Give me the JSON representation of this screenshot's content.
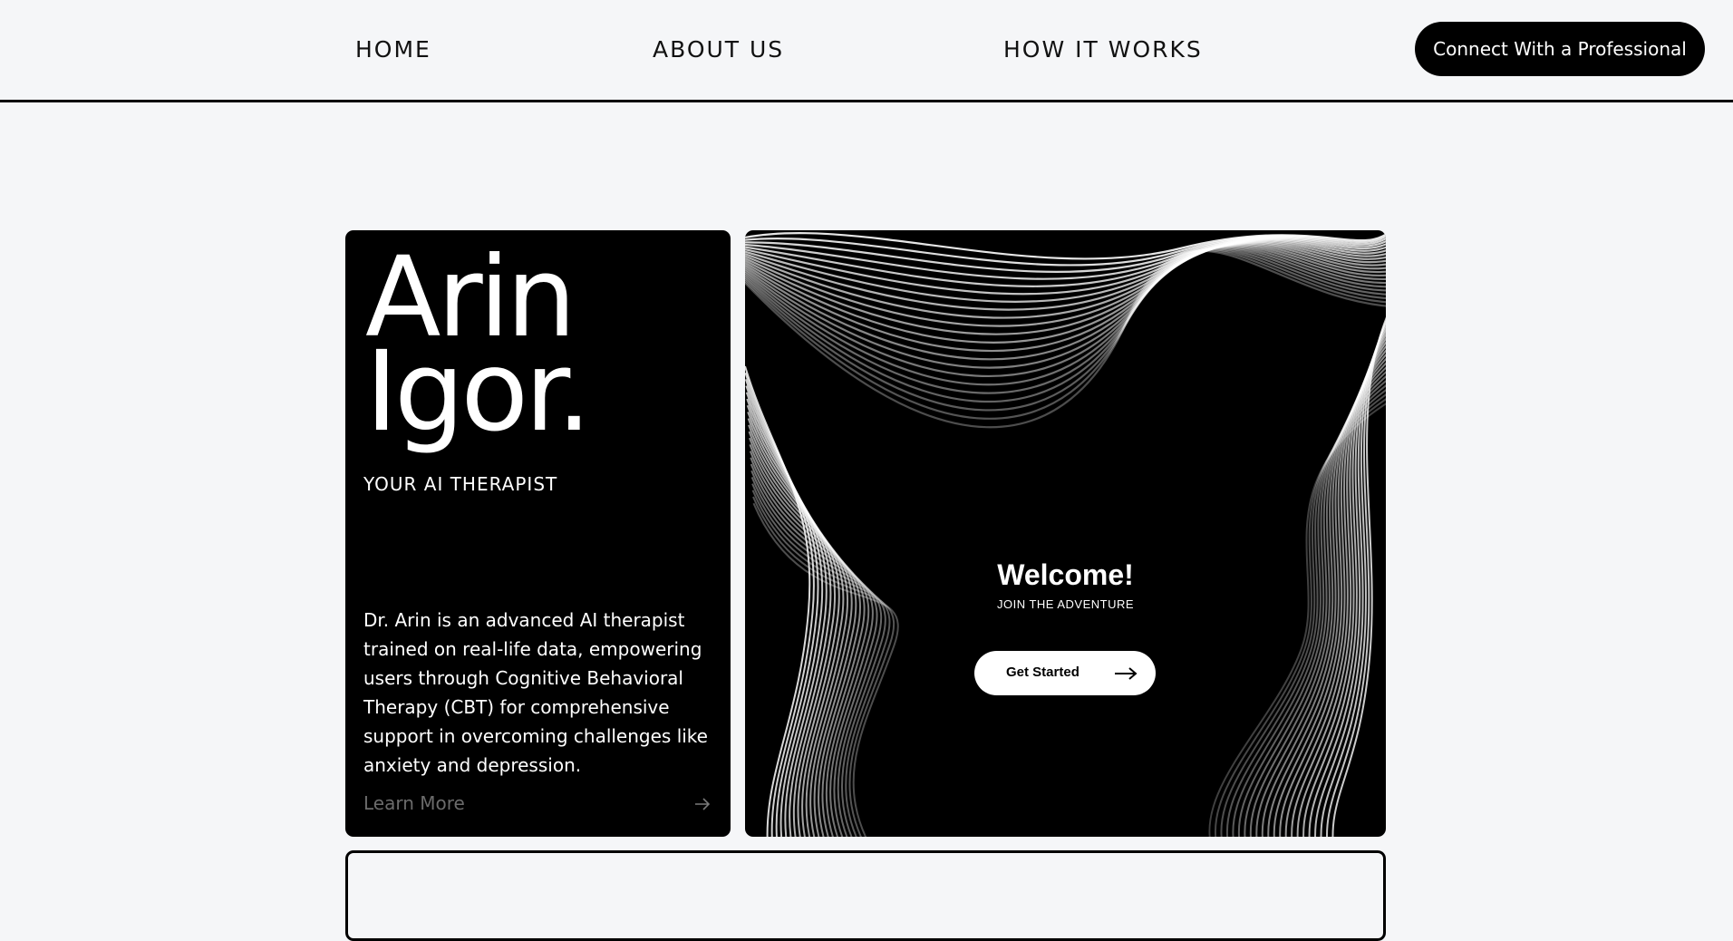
{
  "nav": {
    "home": "HOME",
    "about": "ABOUT US",
    "how": "HOW IT WORKS",
    "cta": "Connect With a Professional"
  },
  "intro_card": {
    "title_line1": "Arin",
    "title_line2": "Igor.",
    "tagline": "YOUR AI THERAPIST",
    "description": "Dr. Arin is an advanced AI therapist trained on real-life data, empowering users through Cognitive Behavioral Therapy (CBT) for comprehensive support in overcoming challenges like anxiety and depression.",
    "learn_more": "Learn More",
    "arrow_icon": "arrow-right-icon"
  },
  "welcome_card": {
    "heading": "Welcome!",
    "subheading": "JOIN THE ADVENTURE",
    "button_label": "Get Started",
    "arrow_icon": "long-arrow-right-icon"
  },
  "colors": {
    "background": "#f5f6f8",
    "card": "#000000",
    "accent_text": "#ffffff",
    "muted": "#6b6b6b"
  }
}
